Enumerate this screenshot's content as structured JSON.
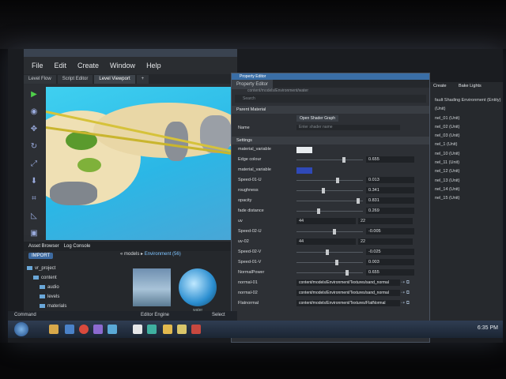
{
  "menu": [
    "File",
    "Edit",
    "Create",
    "Window",
    "Help"
  ],
  "tabs": [
    "Level Flow",
    "Script Editor",
    "Level Viewport"
  ],
  "bottom_tabs": [
    "Asset Browser",
    "Log Console"
  ],
  "import_label": "IMPORT",
  "tree": [
    "vr_project",
    "content",
    "audio",
    "levels",
    "materials"
  ],
  "breadcrumb": {
    "sep": "«  models  ▸",
    "current": "Environment (56)"
  },
  "thumb_labels": [
    "",
    "water"
  ],
  "editor": {
    "title": "Property Editor",
    "tab": "Property Editor",
    "path": "content/models/Environment/water",
    "search": "Search",
    "parent_section": "Parent Material",
    "name_label": "Name",
    "open_shader": "Open Shader Graph",
    "name_placeholder": "Enter shader name",
    "settings_section": "Settings"
  },
  "props": [
    {
      "label": "material_variable",
      "kind": "swatch",
      "color": "#e8ecef"
    },
    {
      "label": "Edge colour",
      "kind": "slider",
      "pos": 0.72,
      "value": "0.655"
    },
    {
      "label": "material_variable",
      "kind": "swatch",
      "color": "#2f49b8"
    },
    {
      "label": "Speed-01-U",
      "kind": "slider",
      "pos": 0.62,
      "value": "0.013"
    },
    {
      "label": "roughness",
      "kind": "slider",
      "pos": 0.4,
      "value": "0.341"
    },
    {
      "label": "opacity",
      "kind": "slider",
      "pos": 0.95,
      "value": "0.831"
    },
    {
      "label": "fade distance",
      "kind": "slider",
      "pos": 0.33,
      "value": "0.269"
    },
    {
      "label": "uv",
      "kind": "pair",
      "a": "44",
      "b": "22"
    },
    {
      "label": "Speed-02-U",
      "kind": "slider",
      "pos": 0.58,
      "value": "-0.005"
    },
    {
      "label": "uv-02",
      "kind": "pair",
      "a": "44",
      "b": "22"
    },
    {
      "label": "Speed-02-V",
      "kind": "slider",
      "pos": 0.46,
      "value": "-0.025"
    },
    {
      "label": "Speed-01-V",
      "kind": "slider",
      "pos": 0.61,
      "value": "0.003"
    },
    {
      "label": "NormalPower",
      "kind": "slider",
      "pos": 0.78,
      "value": "0.655"
    },
    {
      "label": "normal-01",
      "kind": "path",
      "value": "content/models/Environment/Textures/sand_normal"
    },
    {
      "label": "normal-02",
      "kind": "path",
      "value": "content/models/Environment/Textures/sand_normal"
    },
    {
      "label": "Flatnormal",
      "kind": "path",
      "value": "content/models/Environment/Textures/FlatNormal"
    }
  ],
  "right_panel": {
    "tabs": [
      "Create",
      "Bake Lights"
    ],
    "items": [
      "fault Shading Environment (Entity)",
      "(Unit)",
      "nel_01 (Unit)",
      "nel_02 (Unit)",
      "nel_03 (Unit)",
      "nel_1 (Unit)",
      "nel_10 (Unit)",
      "nel_11 (Unit)",
      "nel_12 (Unit)",
      "nel_13 (Unit)",
      "nel_14 (Unit)",
      "nel_15 (Unit)"
    ]
  },
  "cmd": {
    "command": "Command",
    "engine": "Editor Engine",
    "select": "Select"
  },
  "clock": "6:35 PM"
}
